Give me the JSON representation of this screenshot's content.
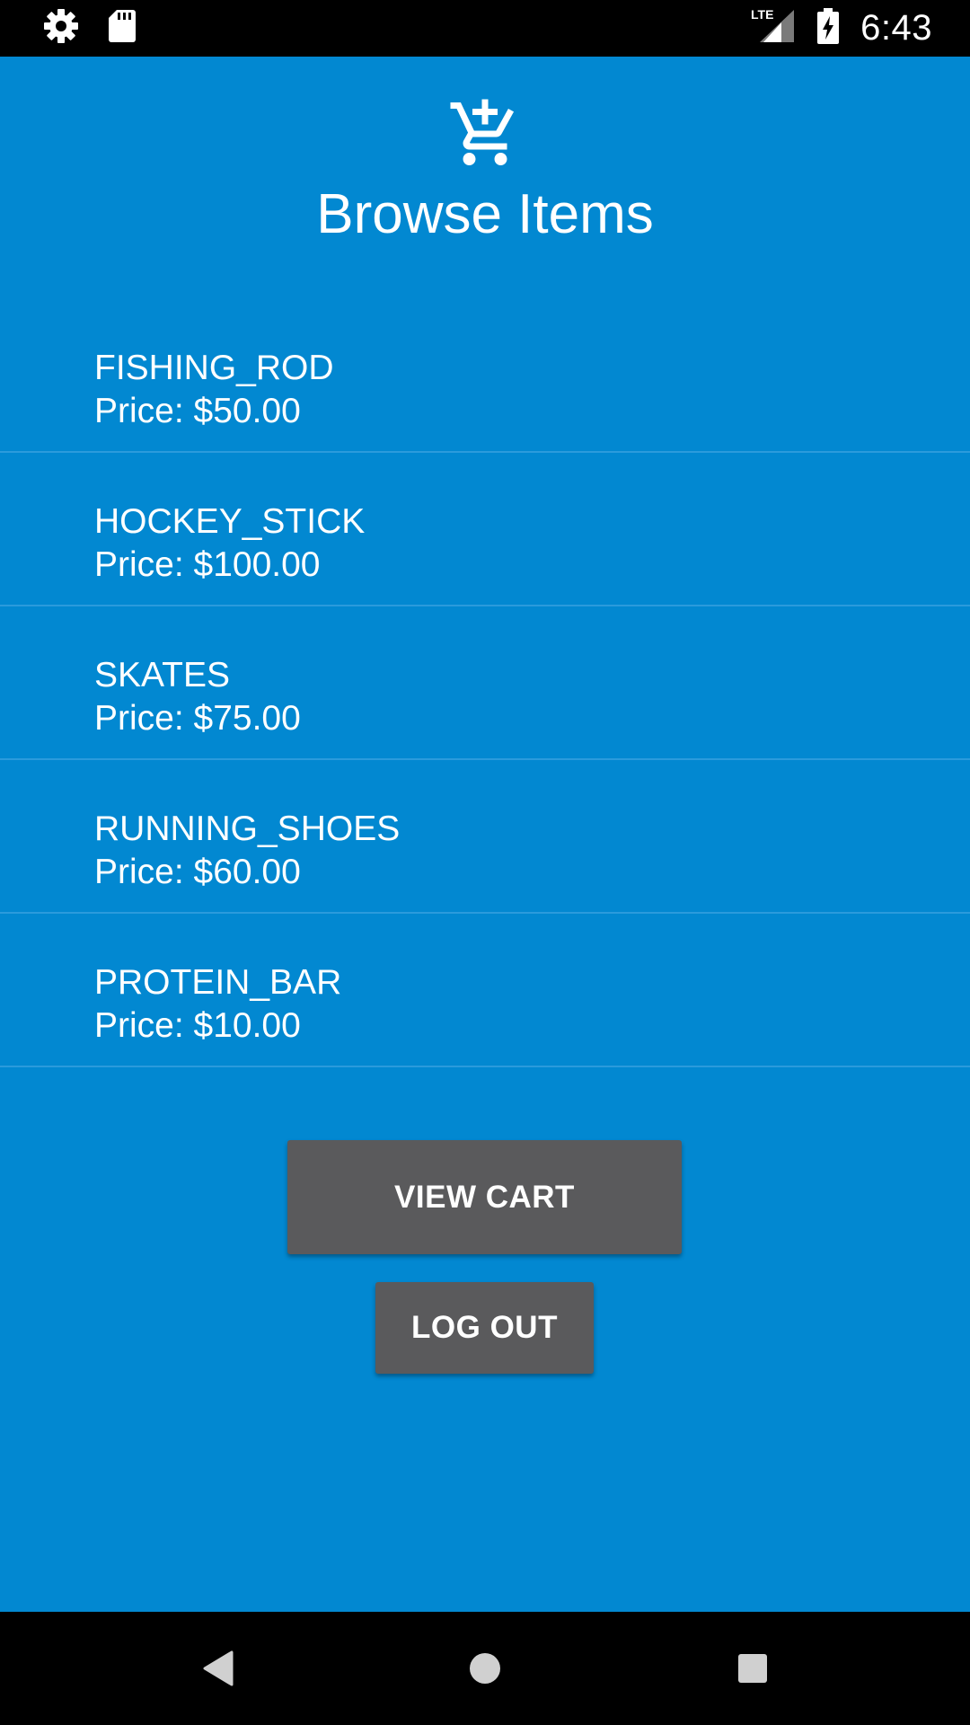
{
  "status_bar": {
    "time": "6:43",
    "network_label": "LTE",
    "icons": [
      "gear-icon",
      "sd-card-icon",
      "signal-icon",
      "battery-charging-icon"
    ]
  },
  "header": {
    "icon": "cart-add-icon",
    "title": "Browse Items"
  },
  "items": [
    {
      "name": "FISHING_ROD",
      "price": "Price: $50.00"
    },
    {
      "name": "HOCKEY_STICK",
      "price": "Price: $100.00"
    },
    {
      "name": "SKATES",
      "price": "Price: $75.00"
    },
    {
      "name": "RUNNING_SHOES",
      "price": "Price: $60.00"
    },
    {
      "name": "PROTEIN_BAR",
      "price": "Price: $10.00"
    }
  ],
  "buttons": {
    "view_cart": "VIEW CART",
    "log_out": "LOG OUT"
  },
  "nav_bar": {
    "icons": [
      "back-icon",
      "home-icon",
      "recents-icon"
    ]
  },
  "colors": {
    "background": "#0288d1",
    "button": "#5a5a5c",
    "divider": "#2b9bdc"
  }
}
